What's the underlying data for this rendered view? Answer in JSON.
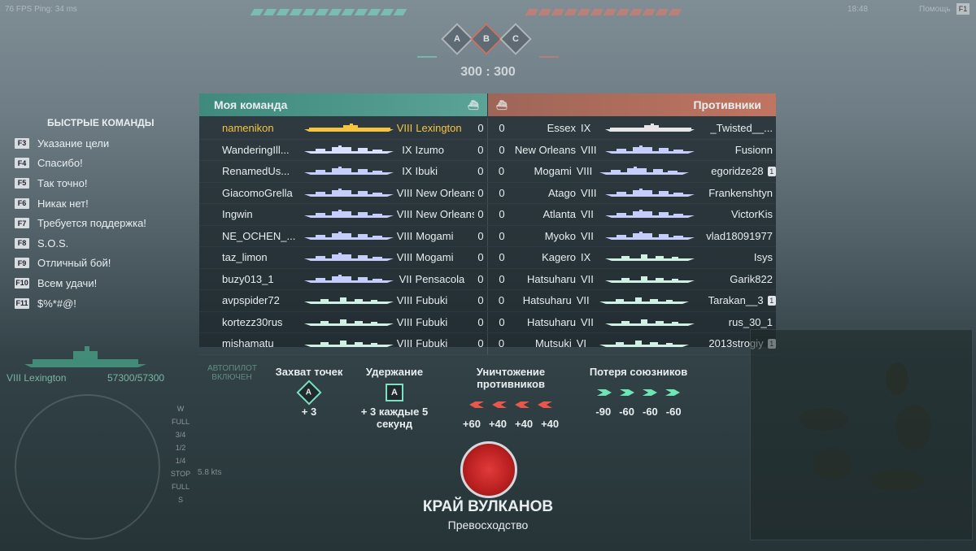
{
  "hud": {
    "fps_ping": "76 FPS  Ping: 34 ms",
    "timer": "18:48",
    "help_label": "Помощь",
    "help_key": "F1",
    "score": "300 : 300",
    "caps": [
      "A",
      "B",
      "C"
    ]
  },
  "teams": {
    "my_label": "Моя команда",
    "enemy_label": "Противники"
  },
  "my_team": [
    {
      "player": "namenikon",
      "tier": "VIII",
      "ship": "Lexington",
      "frags": "0",
      "cls": "me"
    },
    {
      "player": "WanderingIll...",
      "tier": "IX",
      "ship": "Izumo",
      "frags": "0",
      "cls": "bb"
    },
    {
      "player": "RenamedUs...",
      "tier": "IX",
      "ship": "Ibuki",
      "frags": "0",
      "cls": "cruiser"
    },
    {
      "player": "GiacomoGrella",
      "tier": "VIII",
      "ship": "New Orleans",
      "frags": "0",
      "cls": "cruiser"
    },
    {
      "player": "Ingwin",
      "tier": "VIII",
      "ship": "New Orleans",
      "frags": "0",
      "cls": "cruiser"
    },
    {
      "player": "NE_OCHEN_...",
      "tier": "VIII",
      "ship": "Mogami",
      "frags": "0",
      "cls": "cruiser"
    },
    {
      "player": "taz_limon",
      "tier": "VIII",
      "ship": "Mogami",
      "frags": "0",
      "cls": "cruiser"
    },
    {
      "player": "buzy013_1",
      "tier": "VII",
      "ship": "Pensacola",
      "frags": "0",
      "cls": "cruiser"
    },
    {
      "player": "avpspider72",
      "tier": "VIII",
      "ship": "Fubuki",
      "frags": "0",
      "cls": "dd"
    },
    {
      "player": "kortezz30rus",
      "tier": "VIII",
      "ship": "Fubuki",
      "frags": "0",
      "cls": "dd"
    },
    {
      "player": "mishamatu",
      "tier": "VIII",
      "ship": "Fubuki",
      "frags": "0",
      "cls": "dd"
    }
  ],
  "enemy_team": [
    {
      "player": "_Twisted__...",
      "tier": "IX",
      "ship": "Essex",
      "frags": "0",
      "cls": "cv",
      "badge": ""
    },
    {
      "player": "Fusionn",
      "tier": "VIII",
      "ship": "New Orleans",
      "frags": "0",
      "cls": "cruiser",
      "badge": ""
    },
    {
      "player": "egoridze28",
      "tier": "VIII",
      "ship": "Mogami",
      "frags": "0",
      "cls": "cruiser",
      "badge": "1"
    },
    {
      "player": "Frankenshtyn",
      "tier": "VIII",
      "ship": "Atago",
      "frags": "0",
      "cls": "cruiser",
      "badge": ""
    },
    {
      "player": "VictorKis",
      "tier": "VII",
      "ship": "Atlanta",
      "frags": "0",
      "cls": "cruiser",
      "badge": ""
    },
    {
      "player": "vlad18091977",
      "tier": "VII",
      "ship": "Myoko",
      "frags": "0",
      "cls": "cruiser",
      "badge": ""
    },
    {
      "player": "Isys",
      "tier": "IX",
      "ship": "Kagero",
      "frags": "0",
      "cls": "dd",
      "badge": ""
    },
    {
      "player": "Garik822",
      "tier": "VII",
      "ship": "Hatsuharu",
      "frags": "0",
      "cls": "dd",
      "badge": ""
    },
    {
      "player": "Tarakan__3",
      "tier": "VII",
      "ship": "Hatsuharu",
      "frags": "0",
      "cls": "dd",
      "badge": "1"
    },
    {
      "player": "rus_30_1",
      "tier": "VII",
      "ship": "Hatsuharu",
      "frags": "0",
      "cls": "dd",
      "badge": ""
    },
    {
      "player": "2013strogiy",
      "tier": "VI",
      "ship": "Mutsuki",
      "frags": "0",
      "cls": "dd",
      "badge": "1"
    }
  ],
  "quick_commands": {
    "title": "БЫСТРЫЕ КОМАНДЫ",
    "items": [
      {
        "key": "F3",
        "label": "Указание цели"
      },
      {
        "key": "F4",
        "label": "Спасибо!"
      },
      {
        "key": "F5",
        "label": "Так точно!"
      },
      {
        "key": "F6",
        "label": "Никак нет!"
      },
      {
        "key": "F7",
        "label": "Требуется поддержка!"
      },
      {
        "key": "F8",
        "label": "S.O.S."
      },
      {
        "key": "F9",
        "label": "Отличный бой!"
      },
      {
        "key": "F10",
        "label": "Всем удачи!"
      },
      {
        "key": "F11",
        "label": "$%*#@!"
      }
    ]
  },
  "ship_status": {
    "name": "VIII Lexington",
    "hp": "57300/57300",
    "speed": "5.8 kts",
    "autopilot": "АВТОПИЛОТ ВКЛЮЧЕН",
    "throttle": [
      "W",
      "FULL",
      "3/4",
      "1/2",
      "1/4",
      "STOP",
      "FULL",
      "S"
    ]
  },
  "objectives": {
    "capture": {
      "label": "Захват точек",
      "icon": "A",
      "value": "+ 3"
    },
    "hold": {
      "label": "Удержание",
      "icon": "A",
      "value": "+ 3 каждые 5 секунд"
    },
    "destroy": {
      "label": "Уничтожение противников",
      "values": [
        "+60",
        "+40",
        "+40",
        "+40"
      ]
    },
    "loss": {
      "label": "Потеря союзников",
      "values": [
        "-90",
        "-60",
        "-60",
        "-60"
      ]
    }
  },
  "map": {
    "name": "КРАЙ ВУЛКАНОВ",
    "mode": "Превосходство"
  },
  "colors": {
    "ally": "#5aa396",
    "enemy": "#c07561",
    "player_highlight": "#f5c542"
  }
}
